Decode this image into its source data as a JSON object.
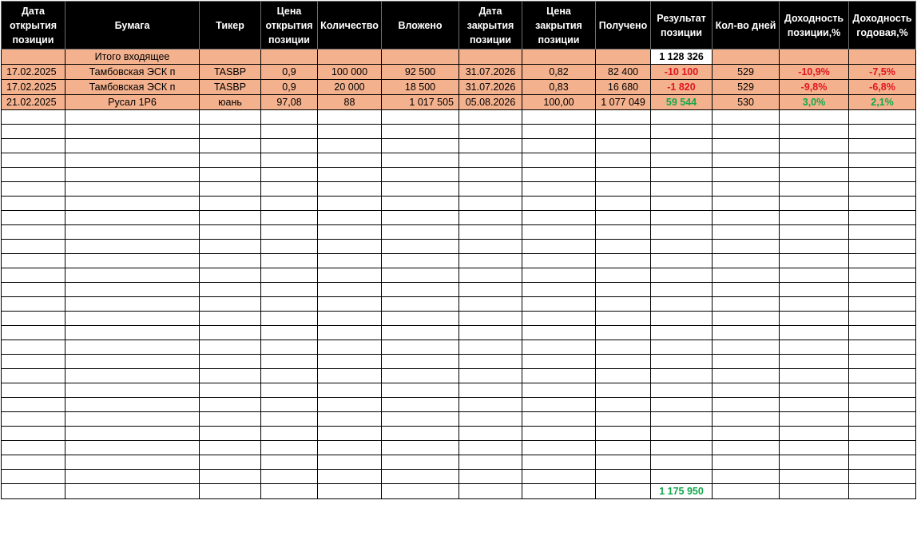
{
  "columns": [
    "Дата открытия позиции",
    "Бумага",
    "Тикер",
    "Цена открытия позиции",
    "Количество",
    "Вложено",
    "Дата закрытия позиции",
    "Цена закрытия позиции",
    "Получено",
    "Результат позиции",
    "Кол-во дней",
    "Доходность позиции,%",
    "Доходность годовая,%"
  ],
  "opening_total": {
    "label": "Итого входящее",
    "value": "1 128 326"
  },
  "rows": [
    {
      "open_date": "17.02.2025",
      "security": "Тамбовская ЭСК п",
      "ticker": "TASBP",
      "open_price": "0,9",
      "quantity": "100 000",
      "invested": "92 500",
      "close_date": "31.07.2026",
      "close_price": "0,82",
      "received": "82 400",
      "result": "-10 100",
      "days": "529",
      "position_yield": "-10,9%",
      "annual_yield": "-7,5%"
    },
    {
      "open_date": "17.02.2025",
      "security": "Тамбовская ЭСК п",
      "ticker": "TASBP",
      "open_price": "0,9",
      "quantity": "20 000",
      "invested": "18 500",
      "close_date": "31.07.2026",
      "close_price": "0,83",
      "received": "16 680",
      "result": "-1 820",
      "days": "529",
      "position_yield": "-9,8%",
      "annual_yield": "-6,8%"
    },
    {
      "open_date": "21.02.2025",
      "security": "Русал 1Р6",
      "ticker": "юань",
      "open_price": "97,08",
      "quantity": "88",
      "invested": "1 017 505",
      "close_date": "05.08.2026",
      "close_price": "100,00",
      "received": "1 077 049",
      "result": "59 544",
      "days": "530",
      "position_yield": "3,0%",
      "annual_yield": "2,1%"
    }
  ],
  "closing_total": {
    "value": "1 175 950"
  },
  "colors": {
    "header_bg": "#000000",
    "header_text": "#ffffff",
    "row_fill": "#f4b18e",
    "negative": "#e0161e",
    "positive": "#12a84a"
  },
  "empty_row_count": 26
}
